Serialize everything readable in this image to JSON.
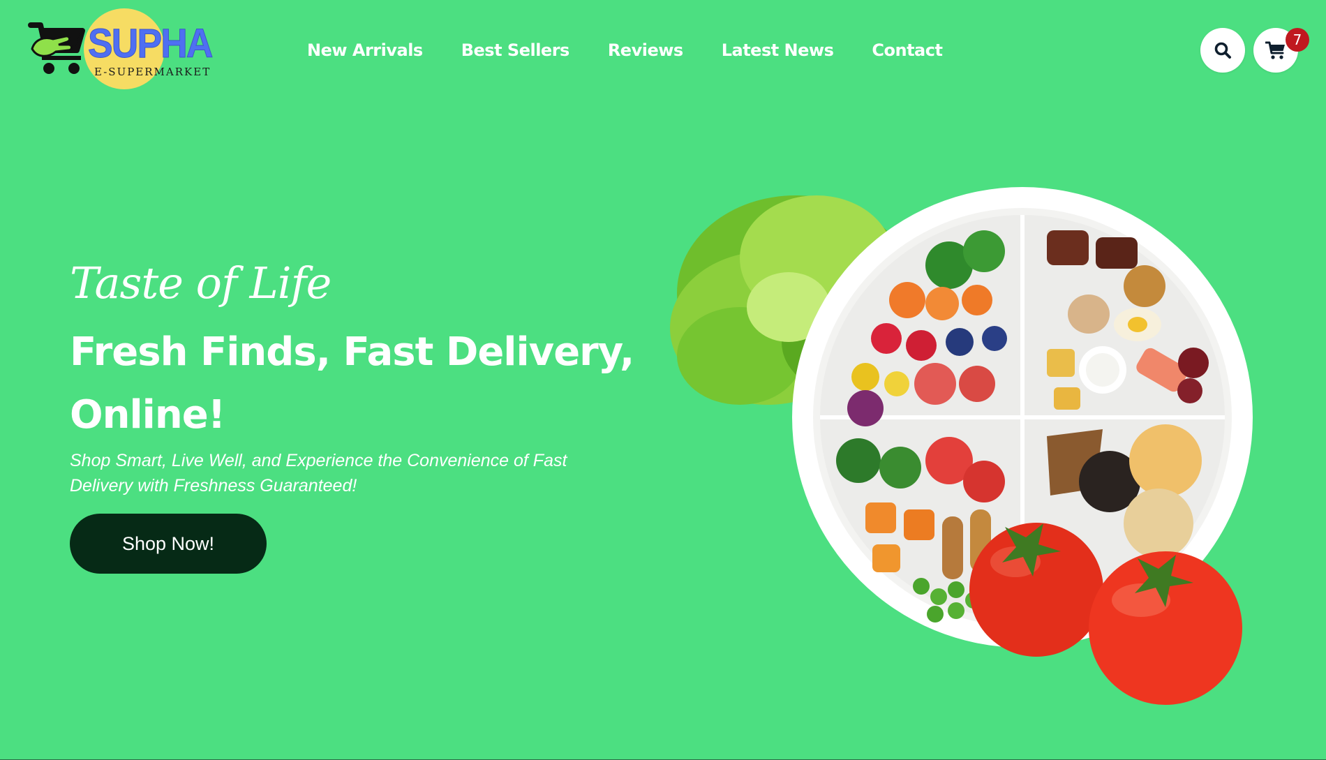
{
  "header": {
    "logo": {
      "title": "SUPHA",
      "subtitle": "E-SUPERMARKET",
      "icon": "shopping-cart-icon"
    },
    "nav": [
      {
        "label": "New Arrivals"
      },
      {
        "label": "Best Sellers"
      },
      {
        "label": "Reviews"
      },
      {
        "label": "Latest News"
      },
      {
        "label": "Contact"
      }
    ],
    "search": {
      "icon": "search-icon"
    },
    "cart": {
      "icon": "shopping-cart-icon",
      "count": "7"
    }
  },
  "hero": {
    "tagline": "Taste of Life",
    "title": "Fresh Finds, Fast Delivery, Online!",
    "subtitle": "Shop Smart, Live Well, and Experience the Convenience of Fast Delivery with Freshness Guaranteed!",
    "cta_label": "Shop Now!",
    "image_alt": "healthy-food-plate-image"
  },
  "colors": {
    "background": "#4cdf81",
    "button": "#062a16",
    "badge": "#c0191f",
    "logo_text": "#4f6ff2",
    "logo_sun": "#f6dc63"
  }
}
